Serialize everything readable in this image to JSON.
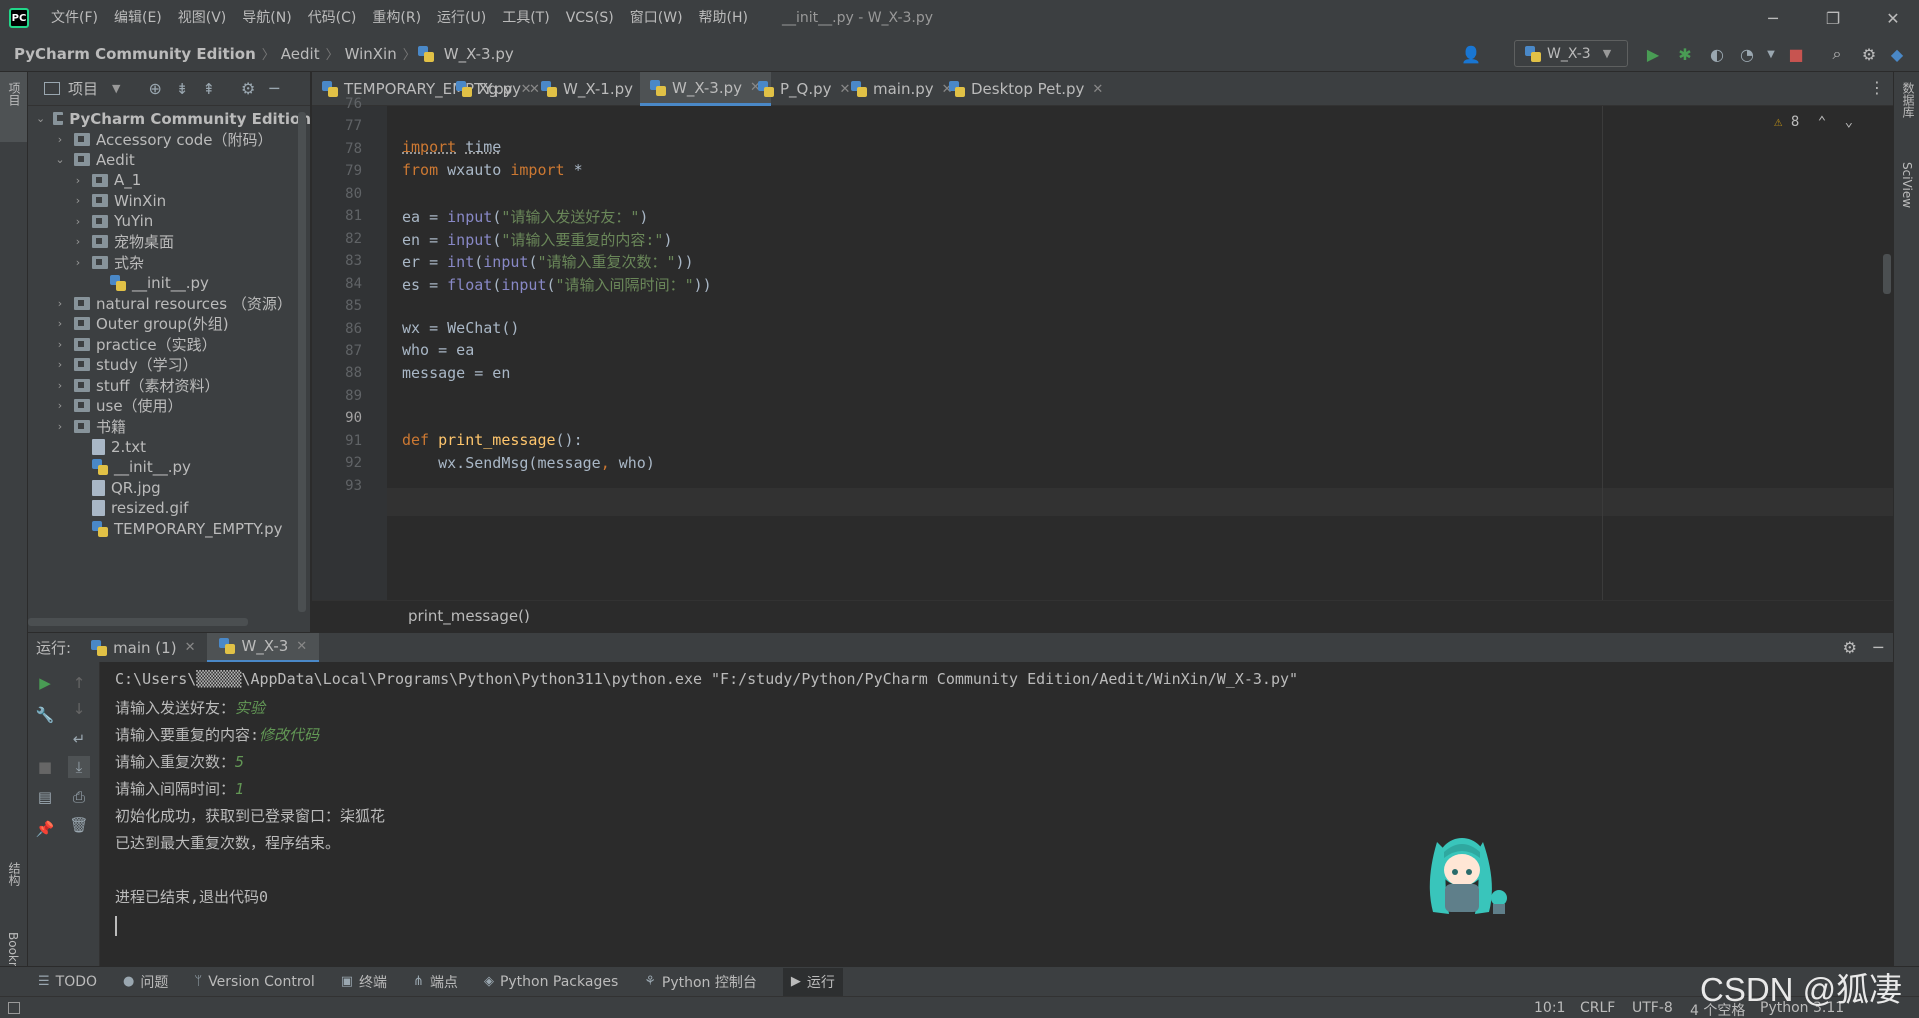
{
  "menubar": {
    "items": [
      "文件(F)",
      "编辑(E)",
      "视图(V)",
      "导航(N)",
      "代码(C)",
      "重构(R)",
      "运行(U)",
      "工具(T)",
      "VCS(S)",
      "窗口(W)",
      "帮助(H)"
    ],
    "window_title": "__init__.py - W_X-3.py"
  },
  "navbar": {
    "breadcrumbs": [
      "PyCharm Community Edition",
      "Aedit",
      "WinXin",
      "W_X-3.py"
    ],
    "run_config": "W_X-3"
  },
  "left_strip": {
    "project": "项目",
    "structure": "结构",
    "bookmarks": "Bookmarks"
  },
  "right_strip": {
    "database": "数据库",
    "sciview": "SciView"
  },
  "project_panel": {
    "title": "项目",
    "tree": [
      {
        "label": "PyCharm Community Edition",
        "kind": "folder",
        "depth": 0,
        "expanded": true
      },
      {
        "label": "Accessory code（附码）",
        "kind": "folder",
        "depth": 1,
        "expanded": false
      },
      {
        "label": "Aedit",
        "kind": "folder",
        "depth": 1,
        "expanded": true
      },
      {
        "label": "A_1",
        "kind": "folder",
        "depth": 2,
        "expanded": false
      },
      {
        "label": "WinXin",
        "kind": "folder",
        "depth": 2,
        "expanded": false
      },
      {
        "label": "YuYin",
        "kind": "folder",
        "depth": 2,
        "expanded": false
      },
      {
        "label": "宠物桌面",
        "kind": "folder",
        "depth": 2,
        "expanded": false
      },
      {
        "label": "式杂",
        "kind": "folder",
        "depth": 2,
        "expanded": false
      },
      {
        "label": "__init__.py",
        "kind": "py",
        "depth": 3
      },
      {
        "label": "natural resources （资源）",
        "kind": "folder",
        "depth": 1,
        "expanded": false
      },
      {
        "label": "Outer group(外组)",
        "kind": "folder",
        "depth": 1,
        "expanded": false
      },
      {
        "label": "practice（实践）",
        "kind": "folder",
        "depth": 1,
        "expanded": false
      },
      {
        "label": "study（学习）",
        "kind": "folder",
        "depth": 1,
        "expanded": false
      },
      {
        "label": "stuff（素材资料）",
        "kind": "folder",
        "depth": 1,
        "expanded": false
      },
      {
        "label": "use（使用）",
        "kind": "folder",
        "depth": 1,
        "expanded": false
      },
      {
        "label": "书籍",
        "kind": "folder",
        "depth": 1,
        "expanded": false
      },
      {
        "label": "2.txt",
        "kind": "file",
        "depth": 2
      },
      {
        "label": "__init__.py",
        "kind": "py",
        "depth": 2
      },
      {
        "label": "QR.jpg",
        "kind": "file",
        "depth": 2
      },
      {
        "label": "resized.gif",
        "kind": "file",
        "depth": 2
      },
      {
        "label": "TEMPORARY_EMPTY.py",
        "kind": "py",
        "depth": 2
      }
    ]
  },
  "tabs": [
    "TEMPORARY_EMPTY.py",
    "Xg.py",
    "W_X-1.py",
    "W_X-3.py",
    "P_Q.py",
    "main.py",
    "Desktop Pet.py"
  ],
  "active_tab": "W_X-3.py",
  "editor": {
    "warnings": "8",
    "line_numbers": [
      "76",
      "77",
      "78",
      "79",
      "80",
      "81",
      "82",
      "83",
      "84",
      "85",
      "86",
      "87",
      "88",
      "89",
      "90",
      "91",
      "92",
      "93"
    ],
    "breadcrumb": "print_message()"
  },
  "run": {
    "label": "运行:",
    "tabs": [
      "main (1)",
      "W_X-3"
    ],
    "command": "C:\\Users\\▒▒▒▒▒\\AppData\\Local\\Programs\\Python\\Python311\\python.exe \"F:/study/Python/PyCharm Community Edition/Aedit/WinXin/W_X-3.py\"",
    "prompt1": "请输入发送好友：",
    "input1": "实验",
    "prompt2": "请输入要重复的内容:",
    "input2": "修改代码",
    "prompt3": "请输入重复次数：",
    "input3": "5",
    "prompt4": "请输入间隔时间：",
    "input4": "1",
    "line5": "初始化成功，获取到已登录窗口：柒狐花",
    "line6": "已达到最大重复次数，程序结束。",
    "line7": "进程已结束,退出代码0"
  },
  "bottom_tools": [
    "TODO",
    "问题",
    "Version Control",
    "终端",
    "端点",
    "Python Packages",
    "Python 控制台",
    "运行"
  ],
  "status": {
    "position": "10:1",
    "line_sep": "CRLF",
    "encoding": "UTF-8",
    "indent": "4 个空格",
    "interpreter": "Python 3.11"
  },
  "watermark": "CSDN @狐凄"
}
